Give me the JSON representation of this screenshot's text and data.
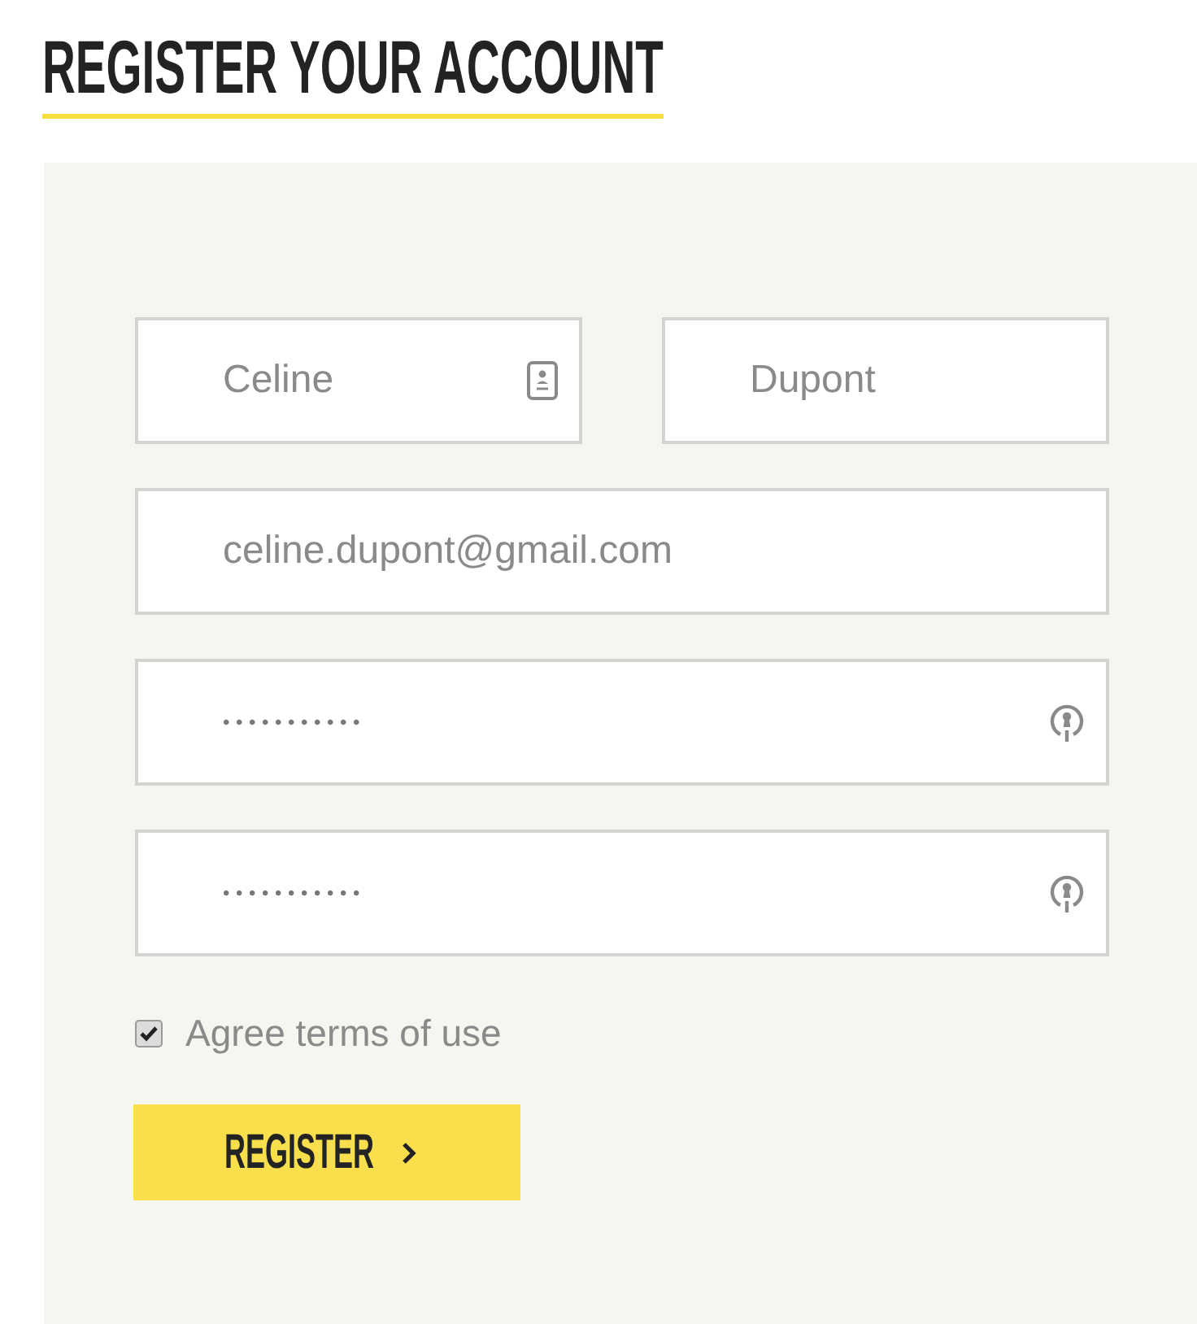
{
  "title": "REGISTER YOUR ACCOUNT",
  "form": {
    "rows": [
      [
        {
          "kind": "first_name",
          "value": "Celine"
        },
        {
          "kind": "last_name",
          "value": "Dupont"
        }
      ],
      [
        {
          "kind": "email",
          "value": "celine.dupont@gmail.com"
        }
      ],
      [
        {
          "kind": "password",
          "value": "•••••••••••"
        }
      ],
      [
        {
          "kind": "confirm_password",
          "value": "•••••••••••"
        }
      ]
    ],
    "agree": {
      "label": "Agree terms of use",
      "checked": true
    },
    "button": {
      "label": "REGISTER"
    }
  }
}
